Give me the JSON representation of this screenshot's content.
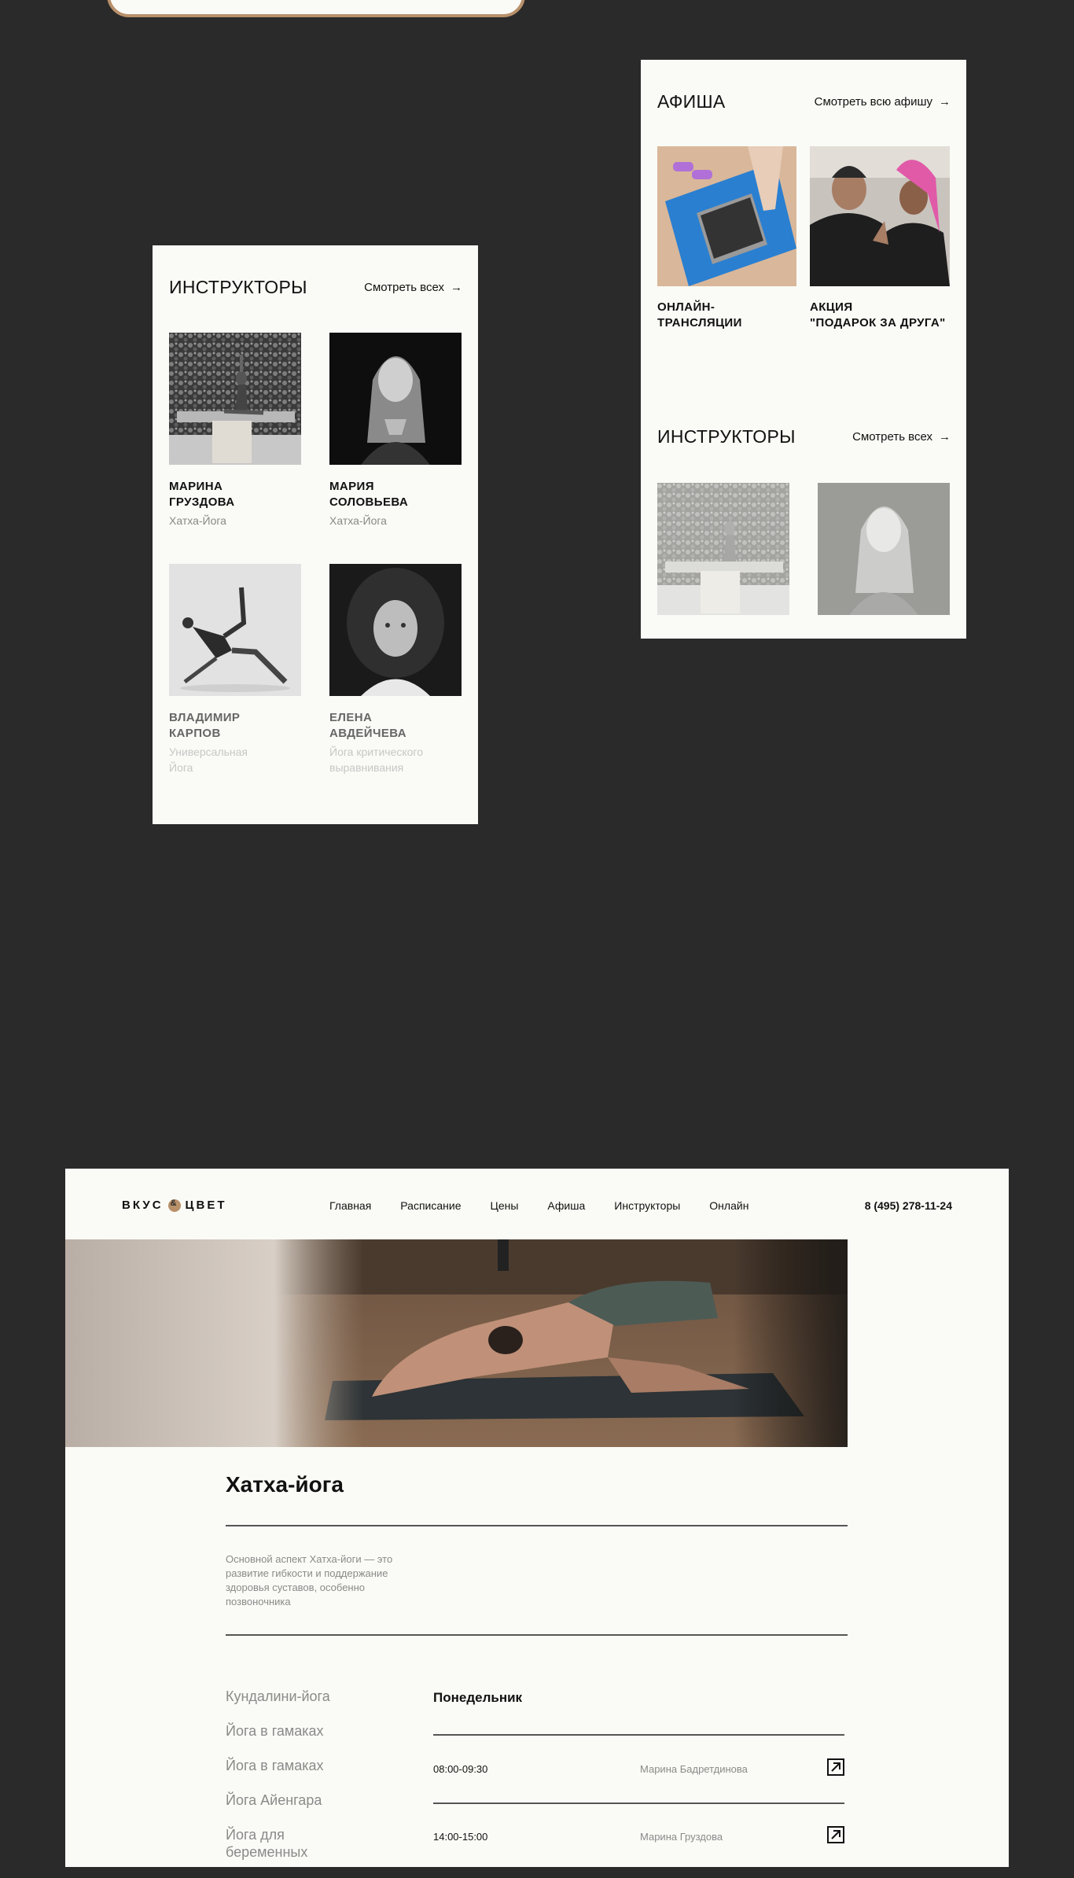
{
  "card_instructors": {
    "title": "ИНСТРУКТОРЫ",
    "see_all": "Смотреть всех",
    "arrow": "→",
    "instructors": [
      {
        "name_line1": "МАРИНА",
        "name_line2": "ГРУЗДОВА",
        "style_line1": "Хатха-Йога",
        "style_line2": ""
      },
      {
        "name_line1": "МАРИЯ",
        "name_line2": "СОЛОВЬЕВА",
        "style_line1": "Хатха-Йога",
        "style_line2": ""
      },
      {
        "name_line1": "ВЛАДИМИР",
        "name_line2": "КАРПОВ",
        "style_line1": "Универсальная",
        "style_line2": "Йога"
      },
      {
        "name_line1": "ЕЛЕНА",
        "name_line2": "АВДЕЙЧЕВА",
        "style_line1": "Йога критического",
        "style_line2": "выравнивания"
      }
    ]
  },
  "card_afisha": {
    "title": "АФИША",
    "see_all": "Смотреть всю афишу",
    "arrow": "→",
    "events": [
      {
        "line1": "ОНЛАЙН-",
        "line2": "ТРАНСЛЯЦИИ"
      },
      {
        "line1": "АКЦИЯ",
        "line2": "\"ПОДАРОК ЗА ДРУГА\""
      }
    ],
    "instructors_title": "ИНСТРУКТОРЫ",
    "instructors_see_all": "Смотреть всех"
  },
  "site": {
    "logo_left": "ВКУС",
    "logo_right": "ЦВЕТ",
    "nav": [
      "Главная",
      "Расписание",
      "Цены",
      "Афиша",
      "Инструкторы",
      "Онлайн"
    ],
    "phone": "8 (495) 278-11-24",
    "class_title": "Хатха-йога",
    "description": "Основной аспект Хатха-йоги — это развитие гибкости и поддержание здоровья суставов, особенно позвоночника",
    "classes": [
      "Кундалини-йога",
      "Йога в гамаках",
      "Йога в гамаках",
      "Йога Айенгара",
      "Йога для беременных"
    ],
    "day": "Понедельник",
    "schedule": [
      {
        "time": "08:00-09:30",
        "instructor": "Марина Бадретдинова"
      },
      {
        "time": "14:00-15:00",
        "instructor": "Марина Груздова"
      }
    ]
  },
  "colors": {
    "background": "#2a2a2a",
    "card": "#fafbf6",
    "accent": "#b8906a",
    "muted_text": "#8a8a8a"
  }
}
